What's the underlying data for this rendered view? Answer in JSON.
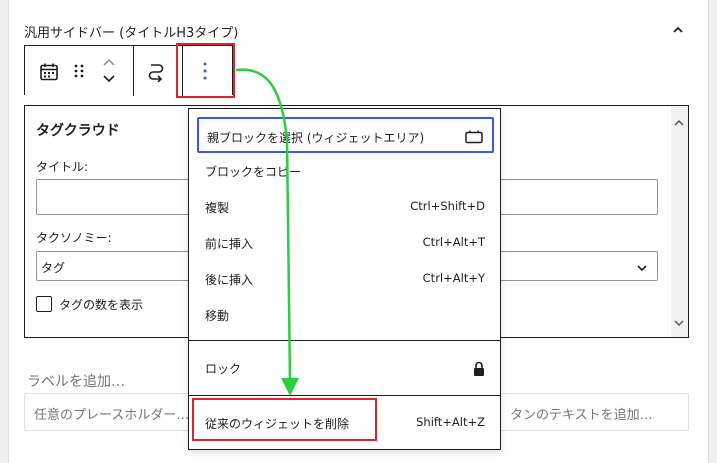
{
  "widget_area": {
    "title": "汎用サイドバー (タイトルH3タイプ)"
  },
  "icons": {
    "collapse": "chevron-up-icon",
    "block_type": "calendar-icon",
    "drag": "drag-handle-icon",
    "move": "up-down-arrows-icon",
    "transform": "transform-icon",
    "more": "more-vertical-icon",
    "parent": "widget-area-icon",
    "lock": "lock-icon"
  },
  "block": {
    "title": "タグクラウド",
    "title_label": "タイトル:",
    "title_value": "",
    "taxonomy_label": "タクソノミー:",
    "taxonomy_value": "タグ",
    "checkbox_label": "タグの数を表示"
  },
  "label_field": {
    "label": "ラベルを追加…"
  },
  "placeholder_field": {
    "left": "任意のプレースホルダー…",
    "right": "タンのテキストを追加…"
  },
  "menu": {
    "items": [
      {
        "label": "親ブロックを選択 (ウィジェットエリア)",
        "shortcut": ""
      },
      {
        "label": "ブロックをコピー",
        "shortcut": ""
      },
      {
        "label": "複製",
        "shortcut": "Ctrl+Shift+D"
      },
      {
        "label": "前に挿入",
        "shortcut": "Ctrl+Alt+T"
      },
      {
        "label": "後に挿入",
        "shortcut": "Ctrl+Alt+Y"
      },
      {
        "label": "移動",
        "shortcut": ""
      },
      {
        "label": "ロック",
        "shortcut": ""
      },
      {
        "label": "従来のウィジェットを削除",
        "shortcut": "Shift+Alt+Z"
      }
    ]
  },
  "colors": {
    "highlight_box": "#e0242a",
    "arrow": "#2ecc40",
    "focus": "#3858e9"
  }
}
